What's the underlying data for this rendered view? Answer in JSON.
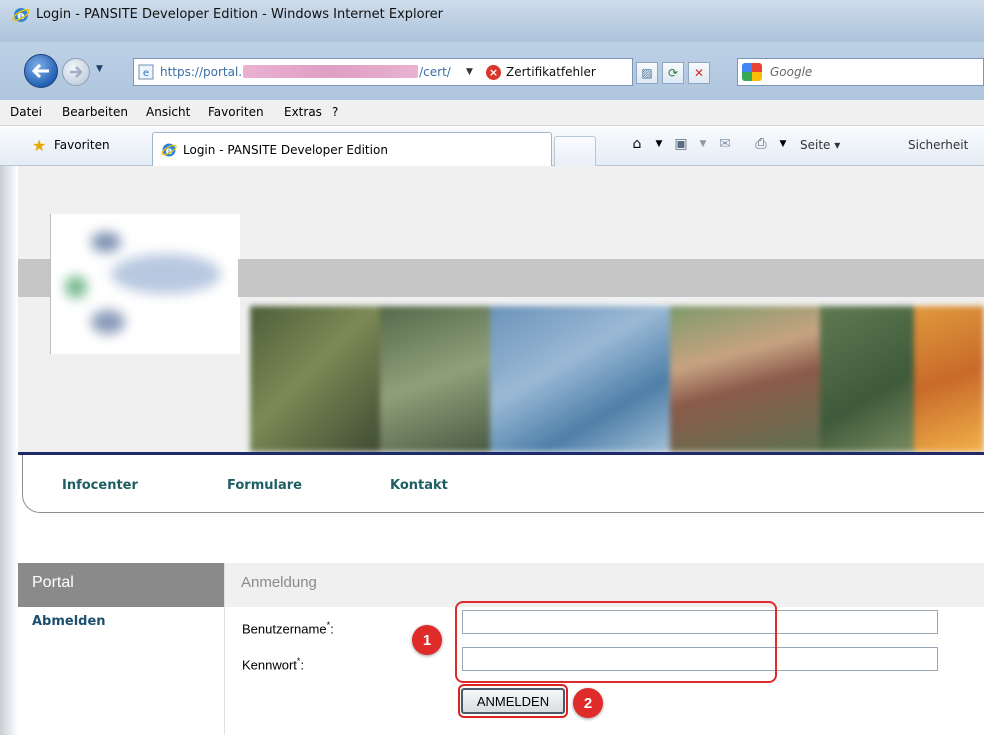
{
  "window": {
    "title": "Login - PANSITE Developer Edition - Windows Internet Explorer"
  },
  "address_bar": {
    "url_start": "https://portal.",
    "url_end": "/cert/",
    "certificate_warning": "Zertifikatfehler"
  },
  "search": {
    "placeholder": "Google"
  },
  "menu": {
    "items": [
      "Datei",
      "Bearbeiten",
      "Ansicht",
      "Favoriten",
      "Extras",
      "?"
    ]
  },
  "favorites_bar": {
    "favorites_label": "Favoriten",
    "tab_title": "Login - PANSITE Developer Edition",
    "commands": [
      "Seite ▾",
      "Sicherheit"
    ]
  },
  "site_nav": {
    "items": [
      "Infocenter",
      "Formulare",
      "Kontakt"
    ]
  },
  "sidebar": {
    "heading": "Portal",
    "links": [
      "Abmelden"
    ]
  },
  "login": {
    "heading": "Anmeldung",
    "username_label": "Benutzername",
    "password_label": "Kennwort",
    "required_marker": "*",
    "username_value": "",
    "password_value": "",
    "submit_label": "ANMELDEN"
  },
  "annotations": {
    "step1": "1",
    "step2": "2",
    "color": "#e02b2b"
  }
}
